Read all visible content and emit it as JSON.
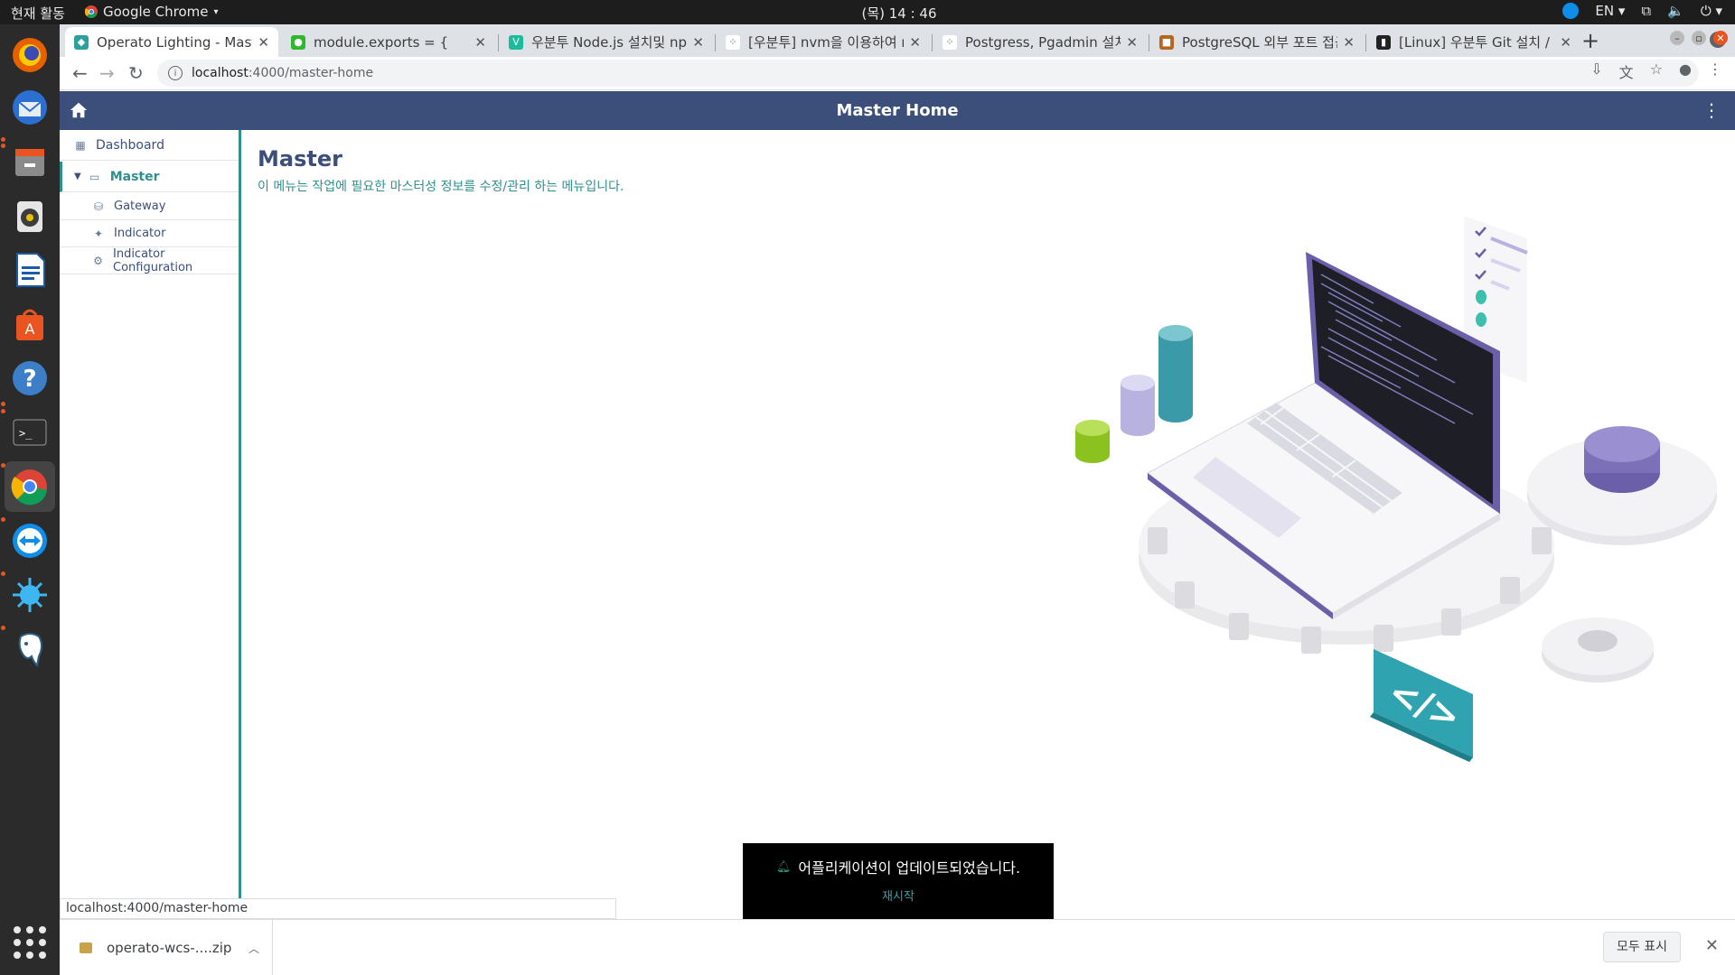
{
  "topbar": {
    "activities": "현재 활동",
    "app_name": "Google Chrome",
    "clock": "(목) 14 : 46",
    "lang": "EN"
  },
  "tabs": [
    {
      "title": "Operato Lighting - Maste",
      "favicon_color": "#2f9e9e",
      "active": true
    },
    {
      "title": "module.exports = {",
      "favicon_color": "#2eb82e",
      "active": false
    },
    {
      "title": "우분투 Node.js 설치및 npm",
      "favicon_color": "#1abc9c",
      "active": false
    },
    {
      "title": "[우분투] nvm을 이용하여 no",
      "favicon_color": "#444444",
      "active": false
    },
    {
      "title": "Postgress, Pgadmin 설치/",
      "favicon_color": "#444444",
      "active": false
    },
    {
      "title": "PostgreSQL 외부 포트 접근",
      "favicon_color": "#b5651d",
      "active": false
    },
    {
      "title": "[Linux] 우분투 Git 설치 / 다",
      "favicon_color": "#222222",
      "active": false
    }
  ],
  "omnibox": {
    "host": "localhost",
    "path": ":4000/master-home"
  },
  "app": {
    "header_title": "Master Home"
  },
  "sidebar": {
    "dashboard": "Dashboard",
    "master": "Master",
    "items": [
      "Gateway",
      "Indicator",
      "Indicator Configuration"
    ]
  },
  "page": {
    "title": "Master",
    "description": "이 메뉴는 작업에 필요한 마스터성 정보를 수정/관리 하는 메뉴입니다."
  },
  "status_url": "localhost:4000/master-home",
  "toast": {
    "message": "어플리케이션이 업데이트되었습니다.",
    "action": "재시작"
  },
  "downloads": {
    "filename": "operato-wcs-....zip",
    "show_all": "모두 표시"
  },
  "colors": {
    "header_bg": "#3b4f7a",
    "accent_teal": "#2f8f8f"
  }
}
